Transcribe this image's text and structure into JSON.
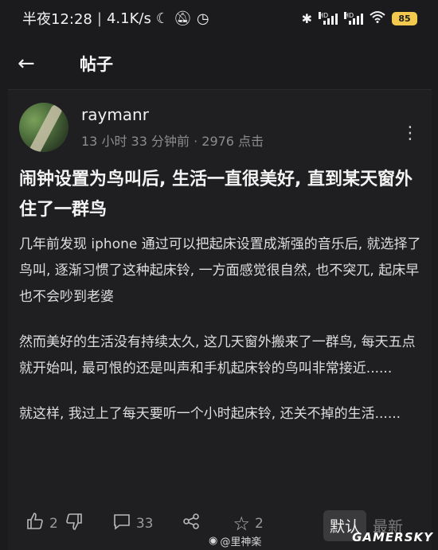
{
  "status_bar": {
    "time": "半夜12:28",
    "separator": "|",
    "net_speed": "4.1K/s",
    "battery": "85",
    "signal_label": "HD"
  },
  "header": {
    "title": "帖子"
  },
  "post": {
    "author": "raymanr",
    "time_ago": "13 小时 33 分钟前",
    "dot": "·",
    "clicks": "2976 点击",
    "title": "闹钟设置为鸟叫后, 生活一直很美好, 直到某天窗外住了一群鸟",
    "paragraphs": [
      "几年前发现 iphone 通过可以把起床设置成渐强的音乐后, 就选择了鸟叫, 逐渐习惯了这种起床铃, 一方面感觉很自然, 也不突兀, 起床早也不会吵到老婆",
      "然而美好的生活没有持续太久, 这几天窗外搬来了一群鸟, 每天五点就开始叫, 最可恨的还是叫声和手机起床铃的鸟叫非常接近......",
      "就这样, 我过上了每天要听一个小时起床铃, 还关不掉的生活......"
    ]
  },
  "toolbar": {
    "likes": "2",
    "comments": "33",
    "stars": "2",
    "sort_default": "默认",
    "sort_latest": "最新"
  },
  "watermarks": {
    "weibo": "@里神楽",
    "site": "GAMERSKY"
  },
  "colors": {
    "background": "#1b1b1d",
    "battery": "#f2c94c",
    "meta_text": "#8c8c8c"
  }
}
